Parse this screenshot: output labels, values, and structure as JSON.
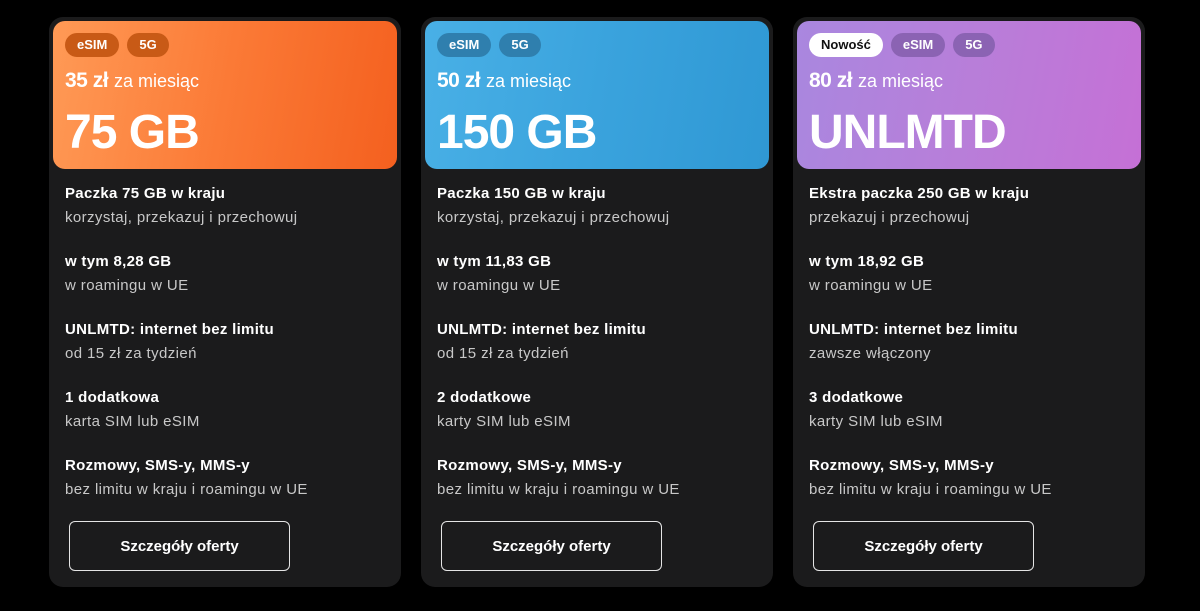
{
  "button_label": "Szczegóły oferty",
  "per_month_label": "za miesiąc",
  "colors": {
    "orange": "#f4601f",
    "blue": "#3aa3dd",
    "purple": "#c570d6",
    "card_bg": "#1b1b1c"
  },
  "cards": [
    {
      "badges": [
        "eSIM",
        "5G"
      ],
      "price": "35 zł",
      "big": "75 GB",
      "features": [
        {
          "title": "Paczka 75 GB w kraju",
          "sub": "korzystaj, przekazuj i przechowuj"
        },
        {
          "title": "w tym 8,28 GB",
          "sub": "w roamingu w UE"
        },
        {
          "title": "UNLMTD: internet bez limitu",
          "sub": "od 15 zł za tydzień"
        },
        {
          "title": "1 dodatkowa",
          "sub": "karta SIM lub eSIM"
        },
        {
          "title": "Rozmowy, SMS-y, MMS-y",
          "sub": "bez limitu w kraju i roamingu w UE"
        }
      ]
    },
    {
      "badges": [
        "eSIM",
        "5G"
      ],
      "price": "50 zł",
      "big": "150 GB",
      "features": [
        {
          "title": "Paczka 150 GB w kraju",
          "sub": "korzystaj, przekazuj i przechowuj"
        },
        {
          "title": "w tym 11,83 GB",
          "sub": "w roamingu w UE"
        },
        {
          "title": "UNLMTD: internet bez limitu",
          "sub": "od 15 zł za tydzień"
        },
        {
          "title": "2 dodatkowe",
          "sub": "karty SIM lub eSIM"
        },
        {
          "title": "Rozmowy, SMS-y, MMS-y",
          "sub": "bez limitu w kraju i roamingu w UE"
        }
      ]
    },
    {
      "badges": [
        "Nowość",
        "eSIM",
        "5G"
      ],
      "price": "80 zł",
      "big": "UNLMTD",
      "features": [
        {
          "title": "Ekstra paczka 250 GB w kraju",
          "sub": "przekazuj i przechowuj"
        },
        {
          "title": "w tym 18,92 GB",
          "sub": "w roamingu w UE"
        },
        {
          "title": "UNLMTD: internet bez limitu",
          "sub": "zawsze włączony"
        },
        {
          "title": "3 dodatkowe",
          "sub": "karty SIM lub eSIM"
        },
        {
          "title": "Rozmowy, SMS-y, MMS-y",
          "sub": "bez limitu w kraju i roamingu w UE"
        }
      ]
    }
  ]
}
